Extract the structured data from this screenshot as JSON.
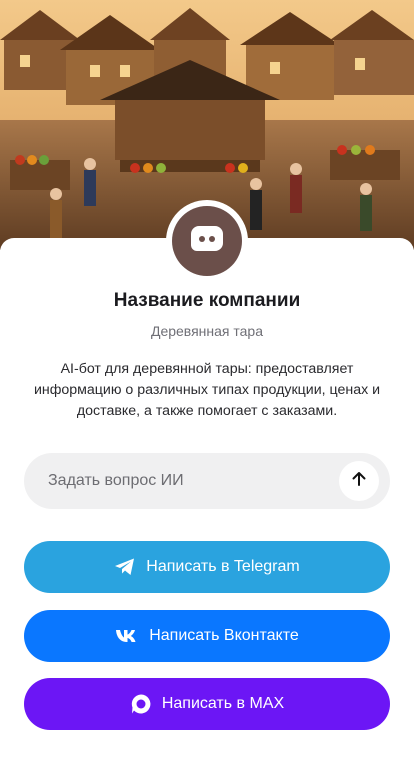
{
  "hero": {
    "image": "market-scene"
  },
  "company": {
    "name": "Название компании",
    "category": "Деревянная тара",
    "description": "AI-бот для деревянной тары: предоставляет информацию о различных типах продукции, ценах и доставке, а также помогает с заказами.",
    "avatar_icon": "chat-bot-icon",
    "avatar_color": "#6b4f4a"
  },
  "ask": {
    "placeholder": "Задать вопрос ИИ",
    "send_icon": "arrow-up-icon"
  },
  "buttons": {
    "telegram": {
      "label": "Написать в Telegram",
      "icon": "telegram-icon",
      "color": "#2aa3df"
    },
    "vk": {
      "label": "Написать Вконтакте",
      "icon": "vk-icon",
      "color": "#0a77ff"
    },
    "max": {
      "label": "Написать в MAX",
      "icon": "max-icon",
      "color": "#6c16f5"
    }
  }
}
